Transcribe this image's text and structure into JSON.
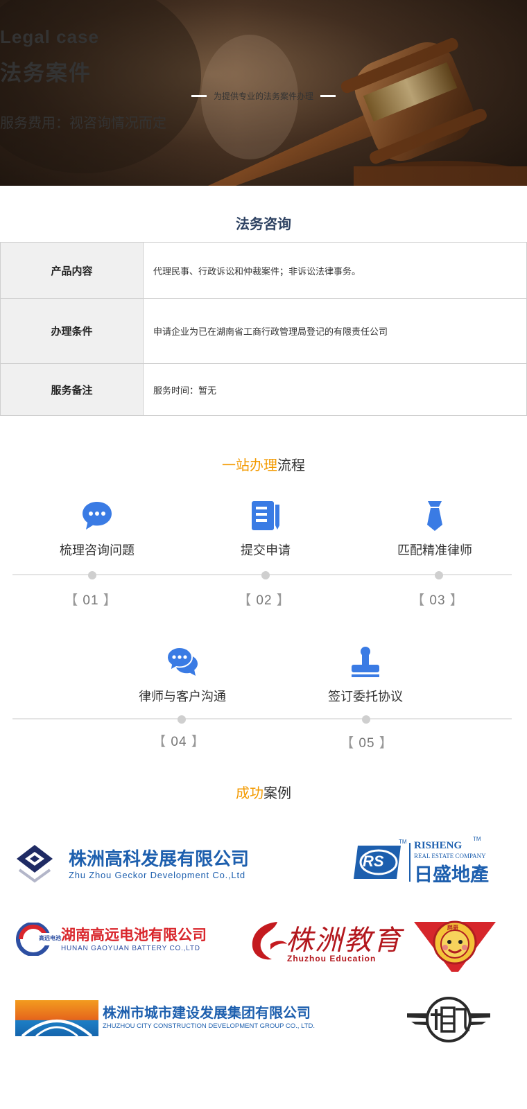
{
  "hero": {
    "title_en": "Legal case",
    "title_cn": "法务案件",
    "tagline": "为提供专业的法务案件办理",
    "fee": "服务费用：视咨询情况而定"
  },
  "consult": {
    "title": "法务咨询",
    "rows": [
      {
        "label": "产品内容",
        "value": "代理民事、行政诉讼和仲裁案件；非诉讼法律事务。"
      },
      {
        "label": "办理条件",
        "value": "申请企业为已在湖南省工商行政管理局登记的有限责任公司"
      },
      {
        "label": "服务备注",
        "value": "服务时间：暂无"
      }
    ]
  },
  "flow": {
    "title_highlight": "一站办理",
    "title_rest": "流程",
    "steps": [
      {
        "label": "梳理咨询问题",
        "num": "01",
        "icon": "chat-bubble-icon"
      },
      {
        "label": "提交申请",
        "num": "02",
        "icon": "document-edit-icon"
      },
      {
        "label": "匹配精准律师",
        "num": "03",
        "icon": "necktie-icon"
      },
      {
        "label": "律师与客户沟通",
        "num": "04",
        "icon": "conversation-icon"
      },
      {
        "label": "签订委托协议",
        "num": "05",
        "icon": "stamp-icon"
      }
    ],
    "bracket_open": "【",
    "bracket_close": "】"
  },
  "cases": {
    "title_highlight": "成功",
    "title_rest": "案例",
    "logos": [
      {
        "cn": "株洲高科发展有限公司",
        "en": "Zhu Zhou Geckor Development Co.,Ltd"
      },
      {
        "brand": "RS",
        "en1": "RISHENG",
        "en2": "REAL ESTATE COMPANY",
        "cn": "日盛地產",
        "tm": "TM"
      },
      {
        "cn": "湖南高远电池有限公司",
        "en": "HUNAN GAOYUAN BATTERY CO.,LTD",
        "badge": "高远电池"
      },
      {
        "cn": "株洲教育",
        "en": "Zhuzhou Education"
      },
      {
        "cn": "胖哥"
      },
      {
        "cn": "株洲市城市建设发展集团有限公司",
        "en": "ZHUZHOU CITY CONSTRUCTION DEVELOPMENT GROUP CO., LTD."
      },
      {
        "cn": "相飞"
      }
    ]
  },
  "colors": {
    "accent": "#f39a00",
    "blue": "#3a7be4",
    "navy": "#2e4262"
  }
}
